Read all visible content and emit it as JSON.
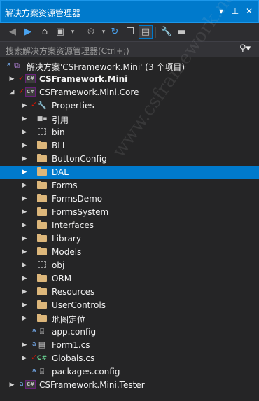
{
  "window": {
    "title": "解决方案资源管理器",
    "icons": [
      "dropdown-icon",
      "pin-icon",
      "close-icon"
    ]
  },
  "toolbar": {
    "buttons": [
      "back-icon",
      "forward-icon",
      "home-icon",
      "switch-views-icon",
      "history-icon",
      "refresh-icon",
      "collapse-all-icon",
      "show-all-files-icon",
      "properties-icon",
      "preview-icon"
    ]
  },
  "search": {
    "placeholder": "搜索解决方案资源管理器(Ctrl+;)"
  },
  "tree": {
    "solution": "解决方案'CSFramework.Mini' (3 个项目)",
    "items": [
      {
        "label": "CSFramework.Mini"
      },
      {
        "label": "CSFramework.Mini.Core"
      },
      {
        "label": "Properties"
      },
      {
        "label": "引用"
      },
      {
        "label": "bin"
      },
      {
        "label": "BLL"
      },
      {
        "label": "ButtonConfig"
      },
      {
        "label": "DAL"
      },
      {
        "label": "Forms"
      },
      {
        "label": "FormsDemo"
      },
      {
        "label": "FormsSystem"
      },
      {
        "label": "Interfaces"
      },
      {
        "label": "Library"
      },
      {
        "label": "Models"
      },
      {
        "label": "obj"
      },
      {
        "label": "ORM"
      },
      {
        "label": "Resources"
      },
      {
        "label": "UserControls"
      },
      {
        "label": "地图定位"
      },
      {
        "label": "app.config"
      },
      {
        "label": "Form1.cs"
      },
      {
        "label": "Globals.cs"
      },
      {
        "label": "packages.config"
      },
      {
        "label": "CSFramework.Mini.Tester"
      }
    ]
  },
  "watermark": "www.csframework.net 开发框架文库",
  "colors": {
    "accent": "#007acc",
    "background": "#252526",
    "folder": "#dcb67a"
  }
}
